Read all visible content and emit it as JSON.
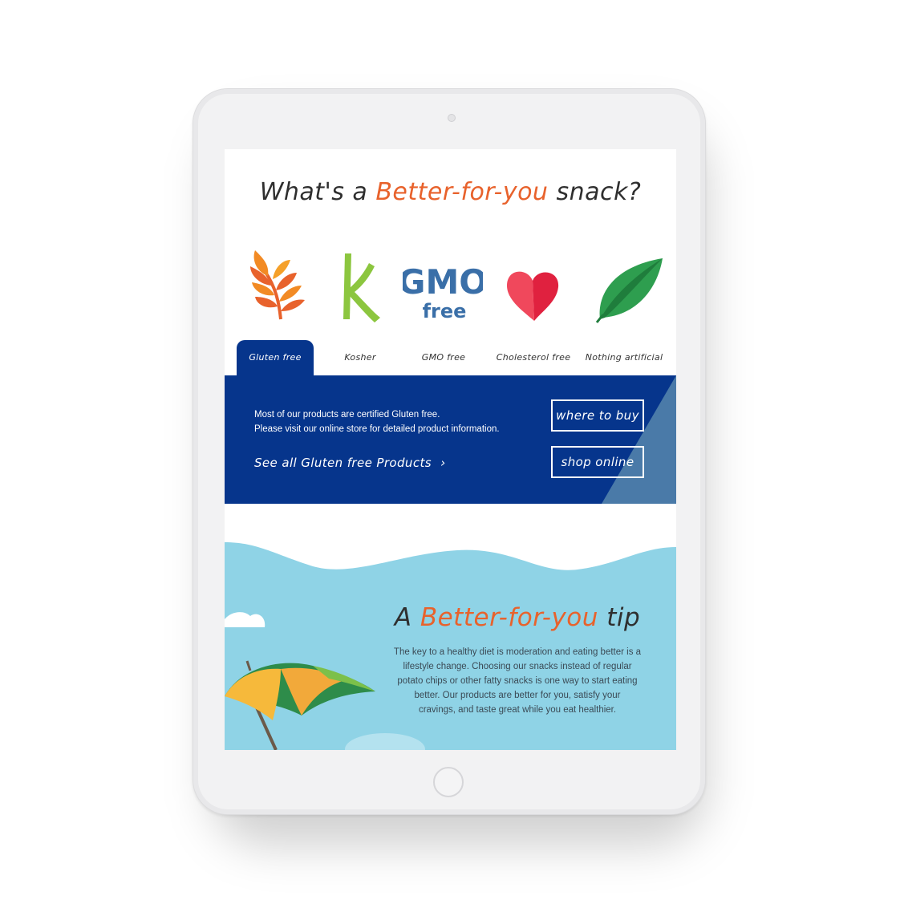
{
  "headline": {
    "prefix": "What's a ",
    "accent": "Better-for-you",
    "suffix": " snack?"
  },
  "icons": [
    "wheat-icon",
    "kosher-k-icon",
    "gmo-free-icon",
    "heart-icon",
    "leaf-icon"
  ],
  "gmo_icon": {
    "top": "GMO",
    "bottom": "free"
  },
  "kosher_icon": {
    "letter": "K"
  },
  "tabs": [
    {
      "label": "Gluten free"
    },
    {
      "label": "Kosher"
    },
    {
      "label": "GMO free"
    },
    {
      "label": "Cholesterol free"
    },
    {
      "label": "Nothing artificial"
    }
  ],
  "panel": {
    "line1": "Most of our products are certified Gluten free.",
    "line2": "Please visit our online store for detailed product information.",
    "link": "See all Gluten free Products",
    "where_to_buy": "where to buy",
    "shop_online": "shop online"
  },
  "tip": {
    "prefix": "A ",
    "accent": "Better-for-you",
    "suffix": " tip",
    "line1": "The key to a healthy diet is moderation and eating better is a",
    "line2": "lifestyle change. Choosing our snacks instead of regular",
    "line3": "potato chips or other fatty snacks is one way to start eating",
    "line4": "better. Our products are better for you, satisfy your",
    "line5": "cravings, and taste great while you eat healthier."
  },
  "colors": {
    "navy": "#06358c",
    "accent_orange": "#e8622c",
    "sky": "#8fd3e6"
  }
}
